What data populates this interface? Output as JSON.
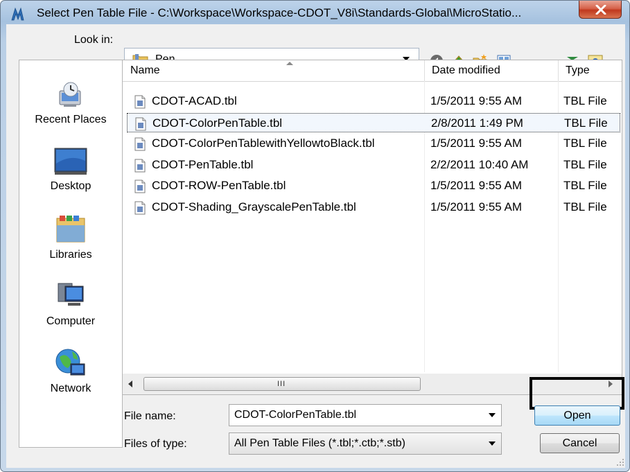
{
  "window": {
    "title": "Select Pen Table File - C:\\Workspace\\Workspace-CDOT_V8i\\Standards-Global\\MicroStatio...",
    "close_glyph": "X"
  },
  "look_in": {
    "label": "Look in:",
    "value": "Pen"
  },
  "places": [
    {
      "label": "Recent Places",
      "icon": "recent-places-icon"
    },
    {
      "label": "Desktop",
      "icon": "desktop-icon"
    },
    {
      "label": "Libraries",
      "icon": "libraries-icon"
    },
    {
      "label": "Computer",
      "icon": "computer-icon"
    },
    {
      "label": "Network",
      "icon": "network-icon"
    }
  ],
  "columns": {
    "name": "Name",
    "date": "Date modified",
    "type": "Type"
  },
  "files": [
    {
      "name": "CDOT-ACAD.tbl",
      "date": "1/5/2011 9:55 AM",
      "type": "TBL File",
      "selected": false
    },
    {
      "name": "CDOT-ColorPenTable.tbl",
      "date": "2/8/2011 1:49 PM",
      "type": "TBL File",
      "selected": true
    },
    {
      "name": "CDOT-ColorPenTablewithYellowtoBlack.tbl",
      "date": "1/5/2011 9:55 AM",
      "type": "TBL File",
      "selected": false
    },
    {
      "name": "CDOT-PenTable.tbl",
      "date": "2/2/2011 10:40 AM",
      "type": "TBL File",
      "selected": false
    },
    {
      "name": "CDOT-ROW-PenTable.tbl",
      "date": "1/5/2011 9:55 AM",
      "type": "TBL File",
      "selected": false
    },
    {
      "name": "CDOT-Shading_GrayscalePenTable.tbl",
      "date": "1/5/2011 9:55 AM",
      "type": "TBL File",
      "selected": false
    }
  ],
  "scrollbar": {
    "grip": "III"
  },
  "file_name": {
    "label": "File name:",
    "value": "CDOT-ColorPenTable.tbl"
  },
  "files_of_type": {
    "label": "Files of type:",
    "value": "All Pen Table Files (*.tbl;*.ctb;*.stb)"
  },
  "buttons": {
    "open": "Open",
    "cancel": "Cancel"
  },
  "colors": {
    "title_gradient_top": "#bdd3ea",
    "close_red": "#c0391e",
    "selection_bg": "#f2f7fd",
    "default_button": "#bee6fd"
  }
}
